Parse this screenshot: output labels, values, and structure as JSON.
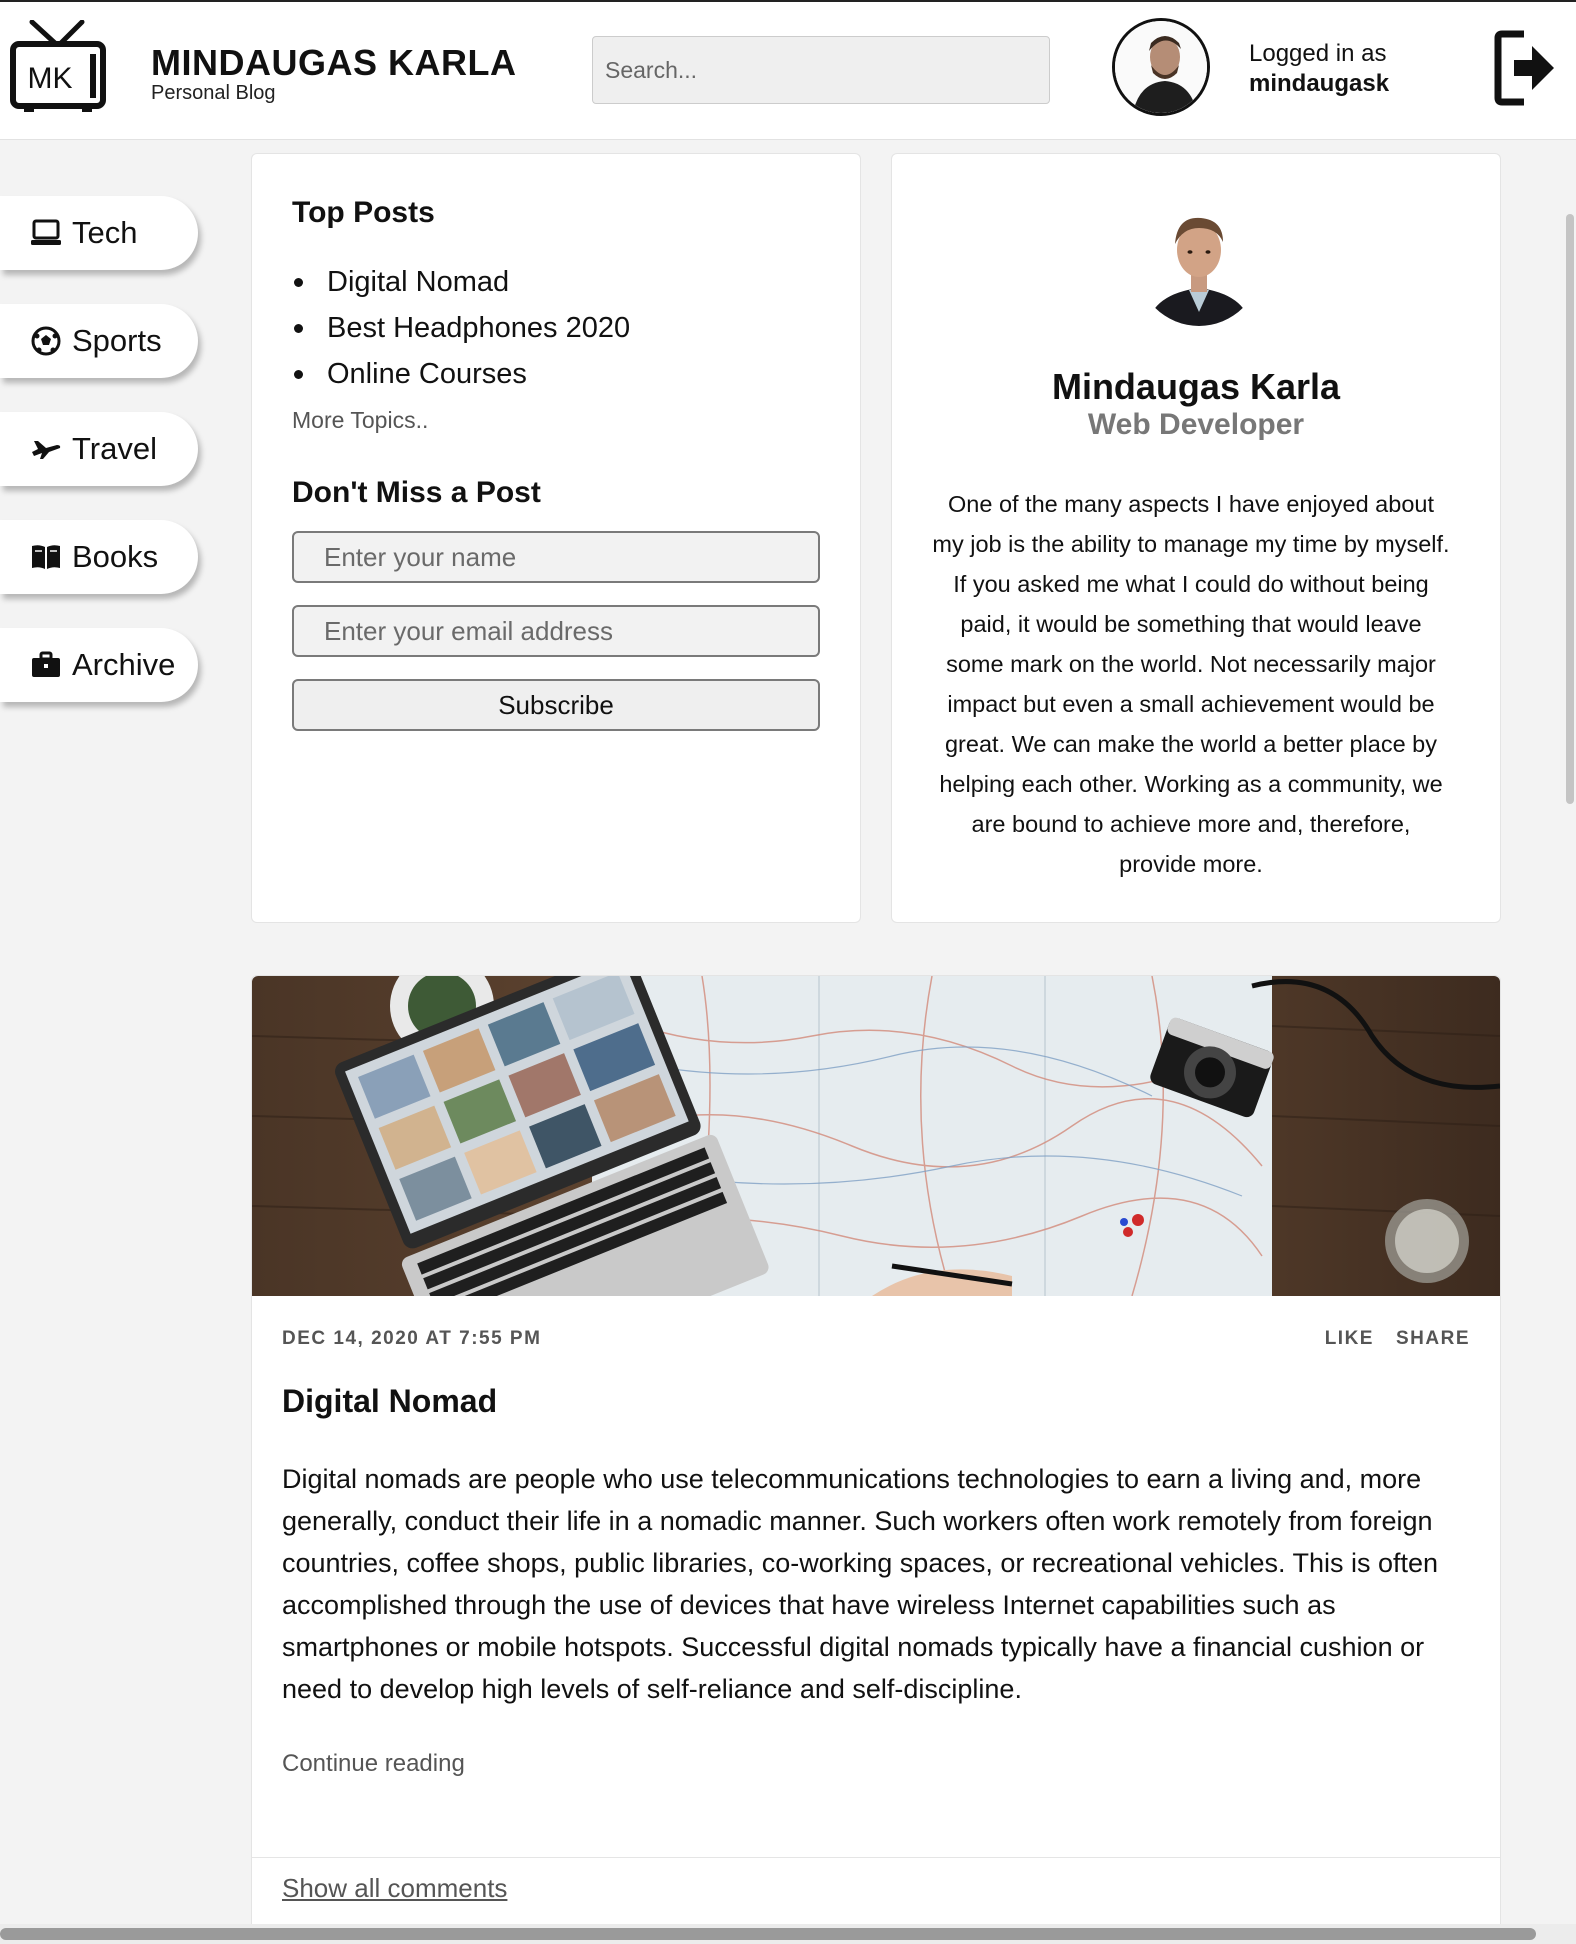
{
  "header": {
    "logo_text": "MK",
    "brand_title": "MINDAUGAS KARLA",
    "brand_subtitle": "Personal Blog",
    "search_placeholder": "Search...",
    "login_label": "Logged in as",
    "login_user": "mindaugask"
  },
  "sidebar": {
    "items": [
      {
        "label": "Tech",
        "icon": "laptop-icon"
      },
      {
        "label": "Sports",
        "icon": "soccer-ball-icon"
      },
      {
        "label": "Travel",
        "icon": "plane-icon"
      },
      {
        "label": "Books",
        "icon": "book-icon"
      },
      {
        "label": "Archive",
        "icon": "briefcase-icon"
      }
    ]
  },
  "top_posts": {
    "heading": "Top Posts",
    "items": [
      "Digital Nomad",
      "Best Headphones 2020",
      "Online Courses"
    ],
    "more_link": "More Topics.."
  },
  "newsletter": {
    "heading": "Don't Miss a Post",
    "name_placeholder": "Enter your name",
    "email_placeholder": "Enter your email address",
    "subscribe_label": "Subscribe"
  },
  "profile": {
    "name": "Mindaugas Karla",
    "role": "Web Developer",
    "bio": "One of the many aspects I have enjoyed about my job is the ability to manage my time by myself. If you asked me what I could do without being paid, it would be something that would leave some mark on the world. Not necessarily major impact but even a small achievement would be great. We can make the world a better place by helping each other. Working as a community, we are bound to achieve more and, therefore, provide more."
  },
  "post": {
    "date": "DEC 14, 2020 AT 7:55 PM",
    "like_label": "LIKE",
    "share_label": "SHARE",
    "title": "Digital Nomad",
    "body": "Digital nomads are people who use telecommunications technologies to earn a living and, more generally, conduct their life in a nomadic manner. Such workers often work remotely from foreign countries, coffee shops, public libraries, co-working spaces, or recreational vehicles. This is often accomplished through the use of devices that have wireless Internet capabilities such as smartphones or mobile hotspots. Successful digital nomads typically have a financial cushion or need to develop high levels of self-reliance and self-discipline.",
    "continue_label": "Continue reading",
    "comments_label": "Show all comments"
  }
}
